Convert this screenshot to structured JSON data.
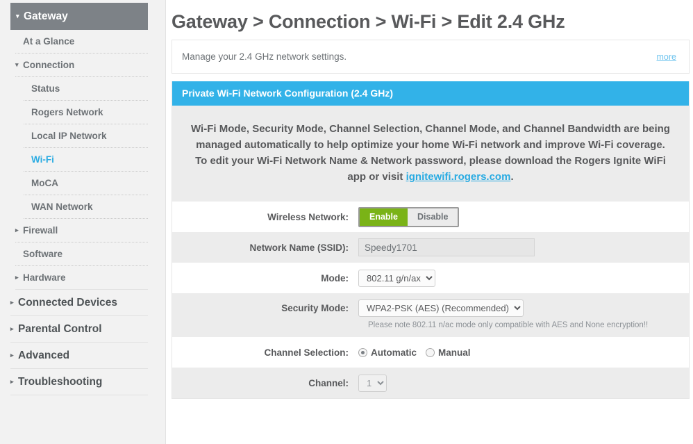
{
  "sidebar": {
    "items": [
      {
        "label": "Gateway",
        "level": 0,
        "caret": "down",
        "state": "active"
      },
      {
        "label": "At a Glance",
        "level": 1,
        "caret": "none",
        "state": "normal"
      },
      {
        "label": "Connection",
        "level": 1,
        "caret": "down",
        "state": "normal"
      },
      {
        "label": "Status",
        "level": 2,
        "caret": "none",
        "state": "normal"
      },
      {
        "label": "Rogers Network",
        "level": 2,
        "caret": "none",
        "state": "normal"
      },
      {
        "label": "Local IP Network",
        "level": 2,
        "caret": "none",
        "state": "normal"
      },
      {
        "label": "Wi-Fi",
        "level": 2,
        "caret": "none",
        "state": "selected"
      },
      {
        "label": "MoCA",
        "level": 2,
        "caret": "none",
        "state": "normal"
      },
      {
        "label": "WAN Network",
        "level": 2,
        "caret": "none",
        "state": "normal"
      },
      {
        "label": "Firewall",
        "level": 1,
        "caret": "right",
        "state": "normal"
      },
      {
        "label": "Software",
        "level": 1,
        "caret": "none",
        "state": "normal"
      },
      {
        "label": "Hardware",
        "level": 1,
        "caret": "right",
        "state": "normal"
      },
      {
        "label": "Connected Devices",
        "level": 0,
        "caret": "right",
        "state": "normal"
      },
      {
        "label": "Parental Control",
        "level": 0,
        "caret": "right",
        "state": "normal"
      },
      {
        "label": "Advanced",
        "level": 0,
        "caret": "right",
        "state": "normal"
      },
      {
        "label": "Troubleshooting",
        "level": 0,
        "caret": "right",
        "state": "normal"
      }
    ]
  },
  "header": {
    "breadcrumb": "Gateway > Connection > Wi-Fi > Edit 2.4 GHz"
  },
  "intro": {
    "text": "Manage your 2.4 GHz network settings.",
    "more_label": "more"
  },
  "panel": {
    "title": "Private Wi-Fi Network Configuration (2.4 GHz)",
    "notice_part1": "Wi-Fi Mode, Security Mode, Channel Selection, Channel Mode, and Channel Bandwidth are being managed automatically to help optimize your home Wi-Fi network and improve Wi-Fi coverage. To edit your Wi-Fi Network Name & Network password, please download the Rogers Ignite WiFi app or visit ",
    "notice_link": "ignitewifi.rogers.com",
    "notice_part2": "."
  },
  "form": {
    "wireless_network": {
      "label": "Wireless Network:",
      "enable_label": "Enable",
      "disable_label": "Disable",
      "selected": "Enable"
    },
    "ssid": {
      "label": "Network Name (SSID):",
      "value": "Speedy1701",
      "placeholder": ""
    },
    "mode": {
      "label": "Mode:",
      "value": "802.11 g/n/ax",
      "options": [
        "802.11 g/n/ax"
      ]
    },
    "security_mode": {
      "label": "Security Mode:",
      "value": "WPA2-PSK (AES) (Recommended)",
      "options": [
        "WPA2-PSK (AES) (Recommended)"
      ],
      "note": "Please note 802.11 n/ac mode only compatible with AES and None encryption!!"
    },
    "channel_selection": {
      "label": "Channel Selection:",
      "automatic_label": "Automatic",
      "manual_label": "Manual",
      "selected": "Automatic"
    },
    "channel": {
      "label": "Channel:",
      "value": "1",
      "options": [
        "1"
      ]
    }
  },
  "colors": {
    "accent_blue": "#32b2e8",
    "link_blue": "#29abe2",
    "enable_green": "#7ab317",
    "sidebar_active": "#7d8287",
    "row_alt": "#ececec"
  }
}
